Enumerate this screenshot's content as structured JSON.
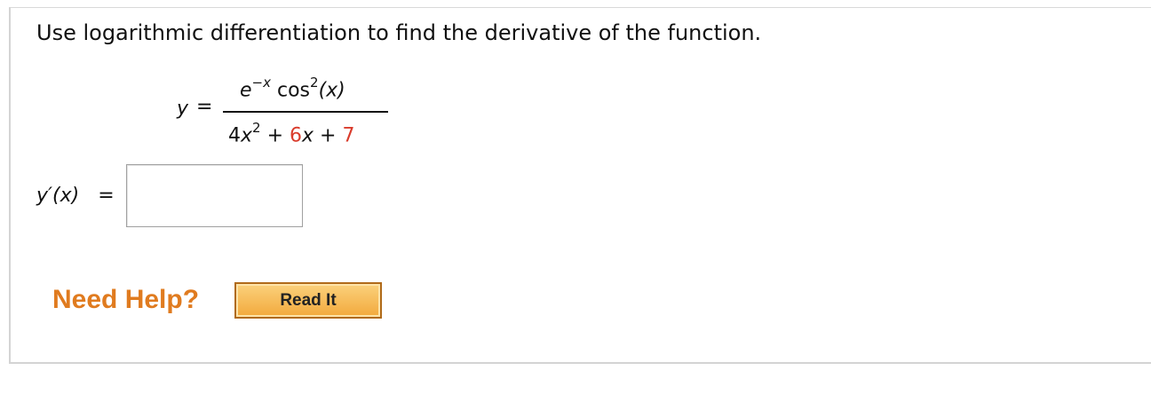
{
  "question": {
    "prompt": "Use logarithmic differentiation to find the derivative of the function."
  },
  "equation": {
    "lhs": "y",
    "equals": "=",
    "numerator": {
      "exp_base": "e",
      "exp_power": "−x",
      "trig": "cos",
      "trig_power": "2",
      "argument": "(x)"
    },
    "denominator": {
      "term1_coef": "4",
      "term1_var": "x",
      "term1_power": "2",
      "plus1": " + ",
      "term2_coef": "6",
      "term2_var": "x",
      "plus2": " + ",
      "term3": "7"
    }
  },
  "answer": {
    "label": "y′(x)",
    "equals": "=",
    "value": ""
  },
  "help": {
    "label": "Need Help?",
    "read_button": "Read It"
  },
  "colors": {
    "highlight": "#d93b2b",
    "help_orange": "#e07b1f"
  }
}
